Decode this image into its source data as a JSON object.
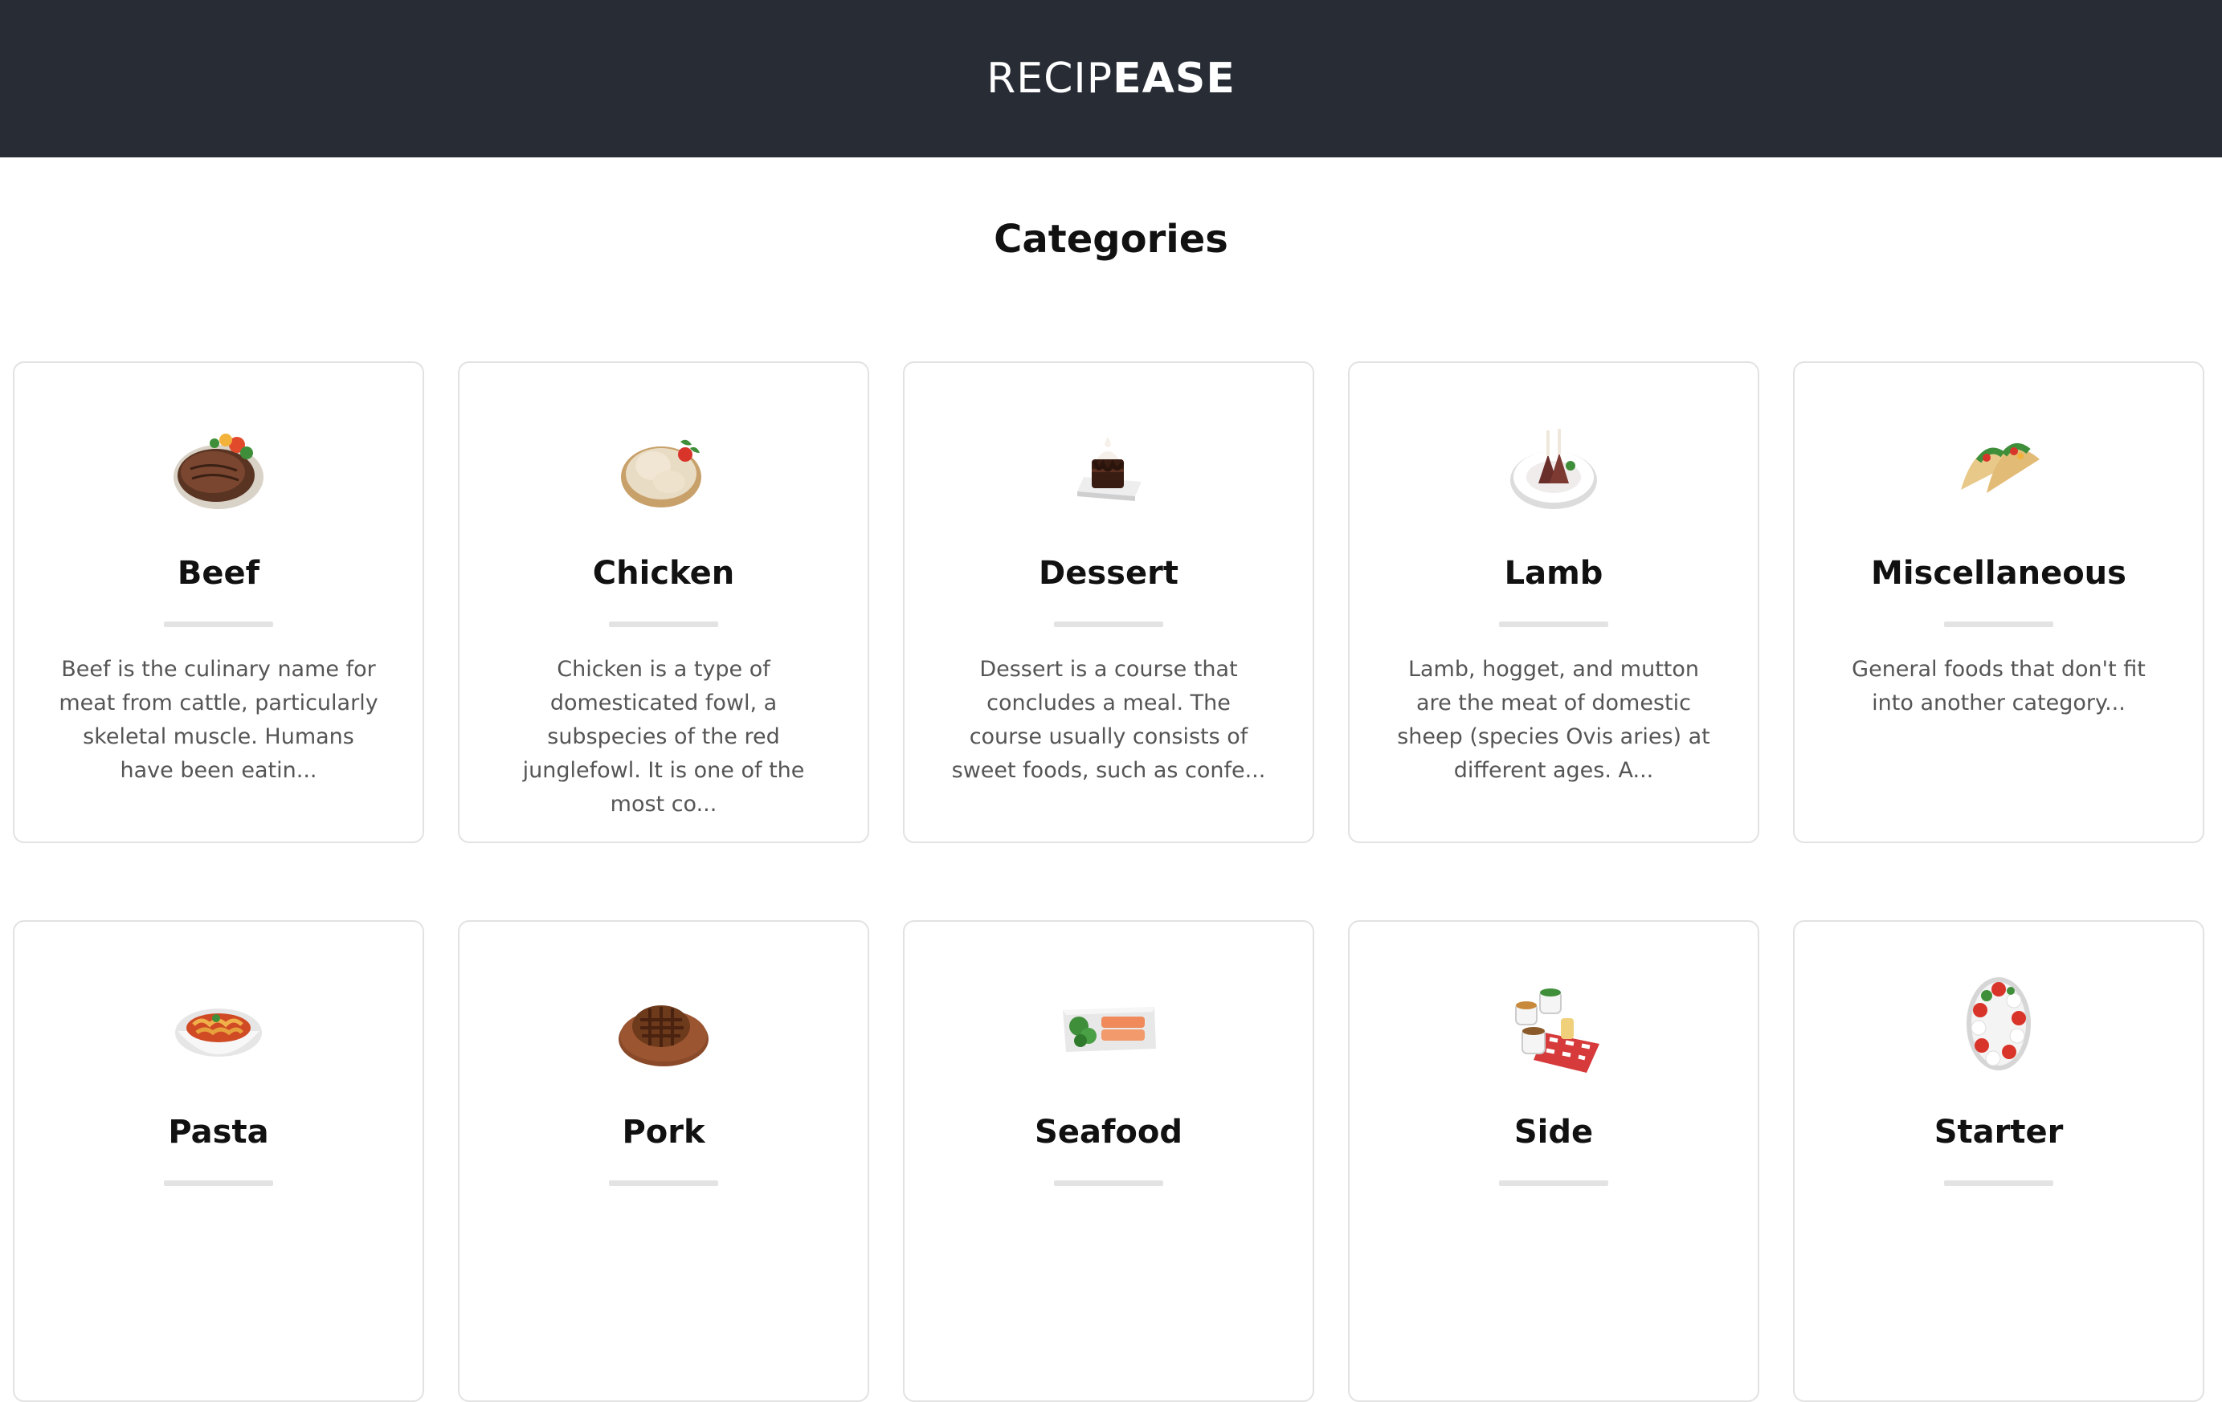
{
  "header": {
    "logo_light": "RECIP",
    "logo_bold": "EASE"
  },
  "page": {
    "title": "Categories"
  },
  "categories": [
    {
      "name": "Beef",
      "icon": "steak-icon",
      "description": "Beef is the culinary name for meat from cattle, particularly skeletal muscle. Humans have been eatin..."
    },
    {
      "name": "Chicken",
      "icon": "chicken-icon",
      "description": "Chicken is a type of domesticated fowl, a subspecies of the red junglefowl. It is one of the most co..."
    },
    {
      "name": "Dessert",
      "icon": "dessert-icon",
      "description": "Dessert is a course that concludes a meal. The course usually consists of sweet foods, such as confe..."
    },
    {
      "name": "Lamb",
      "icon": "lamb-chops-icon",
      "description": "Lamb, hogget, and mutton are the meat of domestic sheep (species Ovis aries) at different ages. A..."
    },
    {
      "name": "Miscellaneous",
      "icon": "tacos-icon",
      "description": "General foods that don't fit into another category..."
    },
    {
      "name": "Pasta",
      "icon": "pasta-icon",
      "description": ""
    },
    {
      "name": "Pork",
      "icon": "pork-icon",
      "description": ""
    },
    {
      "name": "Seafood",
      "icon": "seafood-icon",
      "description": ""
    },
    {
      "name": "Side",
      "icon": "side-dishes-icon",
      "description": ""
    },
    {
      "name": "Starter",
      "icon": "starter-plate-icon",
      "description": ""
    }
  ]
}
